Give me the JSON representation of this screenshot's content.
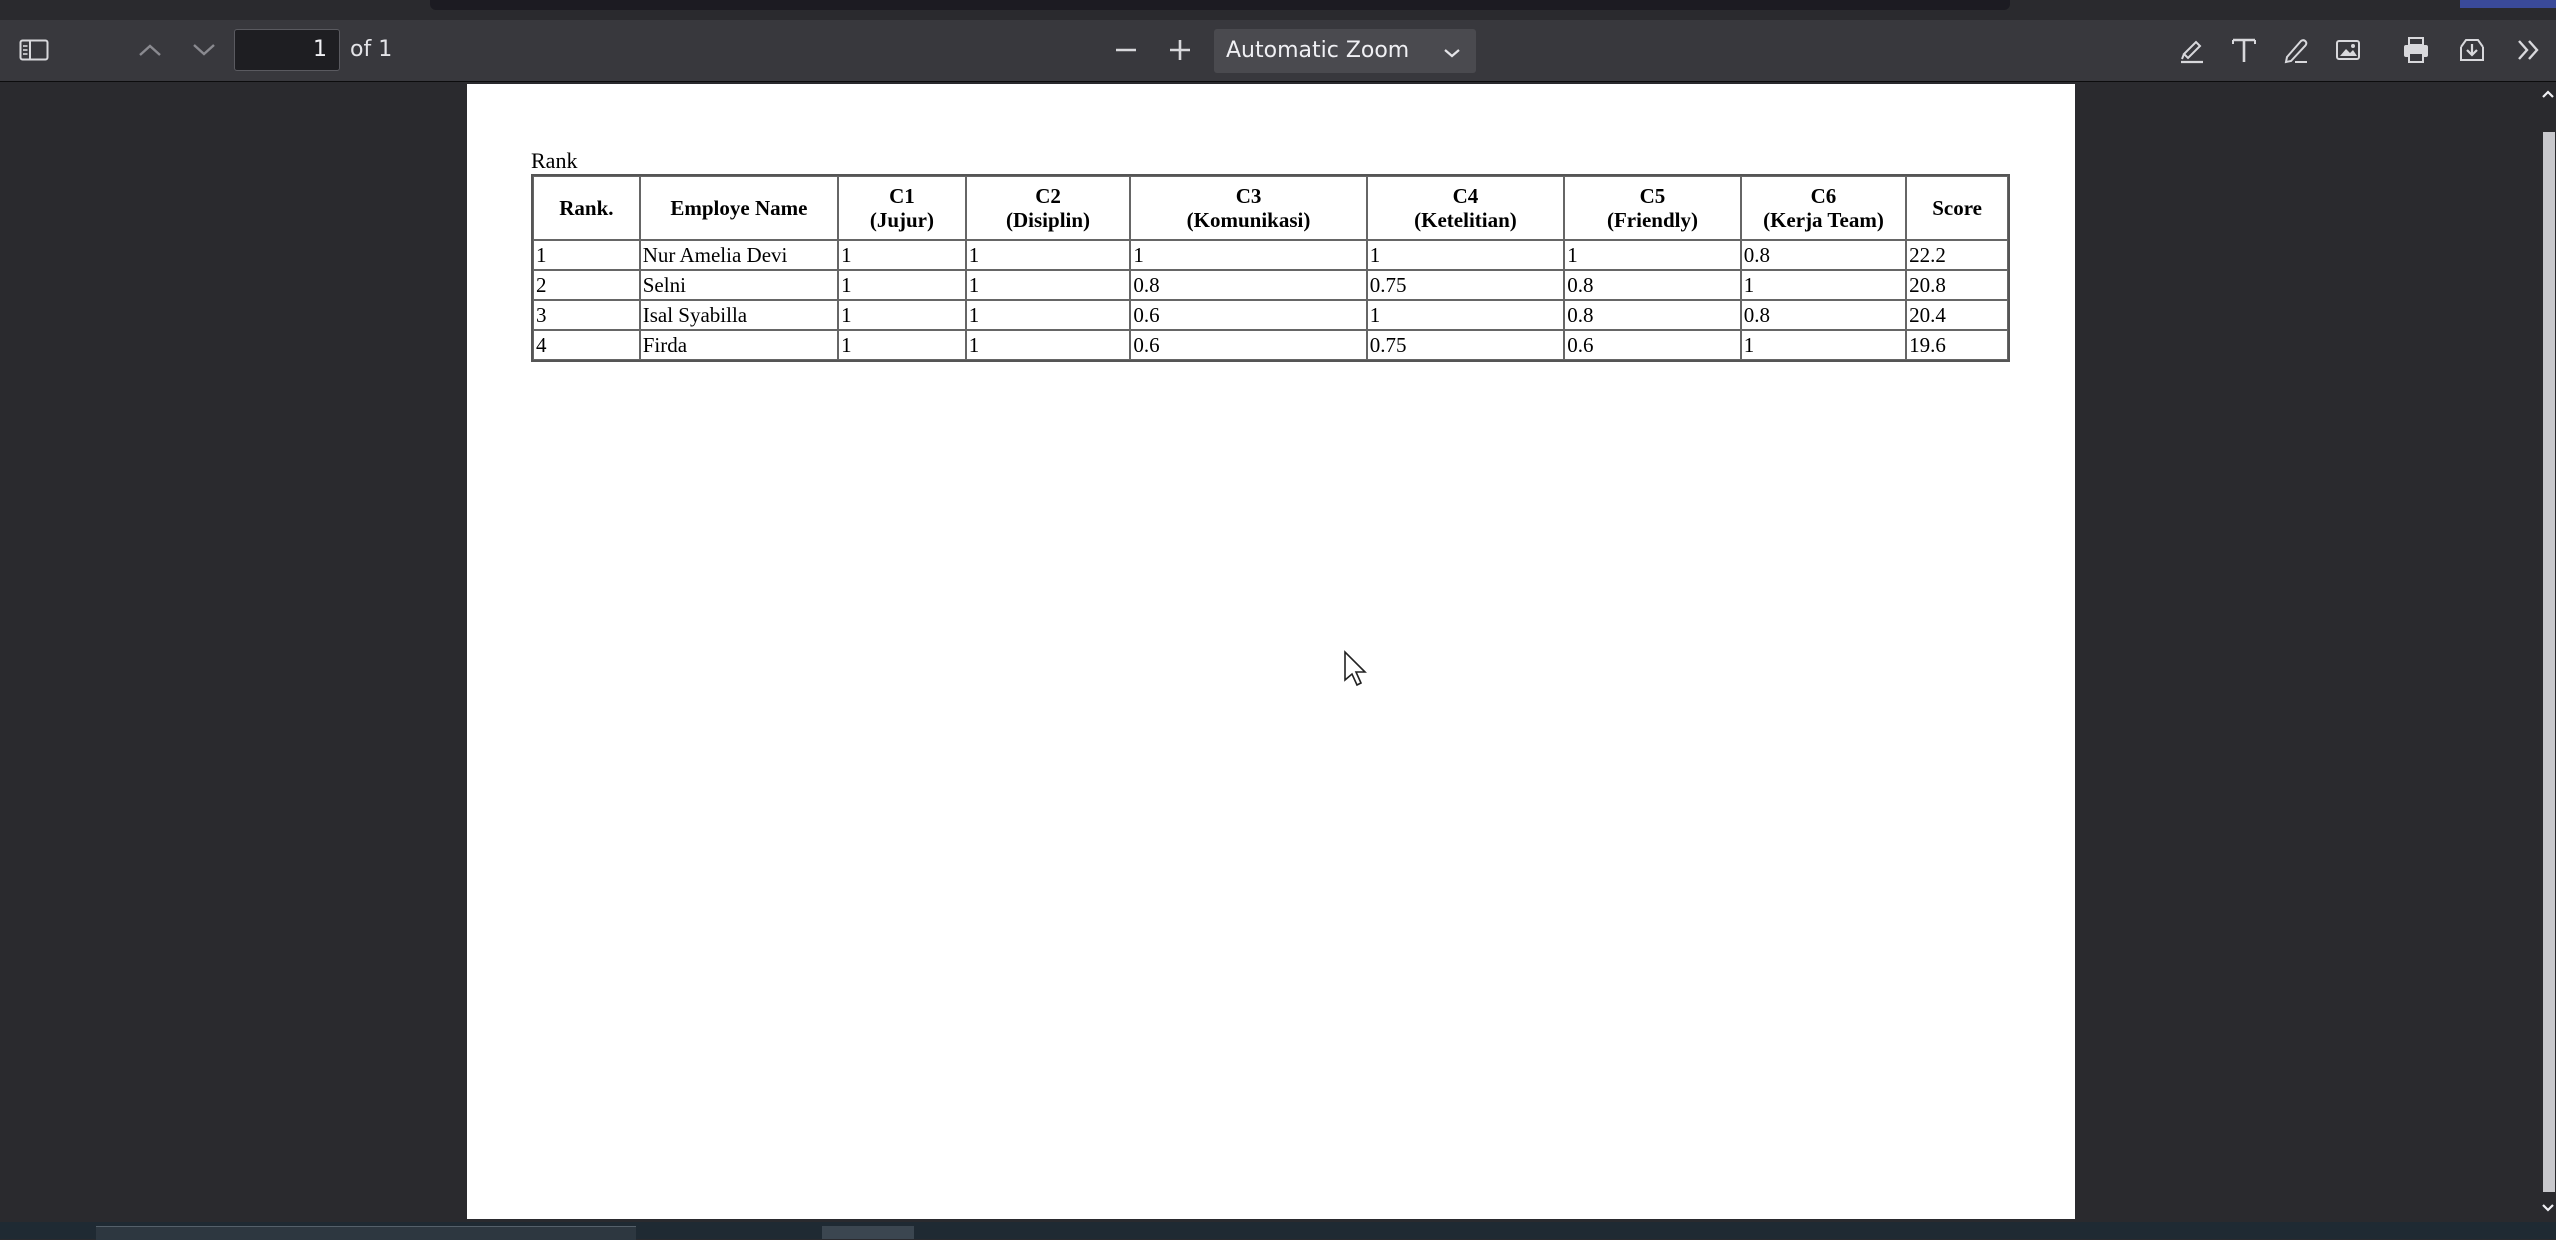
{
  "toolbar": {
    "page_number": "1",
    "page_count": "of 1",
    "zoom": "Automatic Zoom"
  },
  "icons": {
    "sidebar": "sidebar-toggle-icon",
    "prev": "chevron-up-icon",
    "next": "chevron-down-icon",
    "zoom_out": "minus-icon",
    "zoom_in": "plus-icon",
    "highlight": "highlight-pen-icon",
    "text": "text-icon",
    "draw": "pencil-icon",
    "image": "image-icon",
    "print": "printer-icon",
    "save": "download-icon",
    "more": "double-chevron-right-icon"
  },
  "document": {
    "caption": "Rank",
    "table": {
      "headers": [
        "Rank.",
        "Employe Name",
        "C1\n(Jujur)",
        "C2\n(Disiplin)",
        "C3\n(Komunikasi)",
        "C4\n(Ketelitian)",
        "C5\n(Friendly)",
        "C6\n(Kerja Team)",
        "Score"
      ],
      "rows": [
        [
          "1",
          "Nur Amelia Devi",
          "1",
          "1",
          "1",
          "1",
          "1",
          "0.8",
          "22.2"
        ],
        [
          "2",
          "Selni",
          "1",
          "1",
          "0.8",
          "0.75",
          "0.8",
          "1",
          "20.8"
        ],
        [
          "3",
          "Isal Syabilla",
          "1",
          "1",
          "0.6",
          "1",
          "0.8",
          "0.8",
          "20.4"
        ],
        [
          "4",
          "Firda",
          "1",
          "1",
          "0.6",
          "0.75",
          "0.6",
          "1",
          "19.6"
        ]
      ]
    }
  }
}
